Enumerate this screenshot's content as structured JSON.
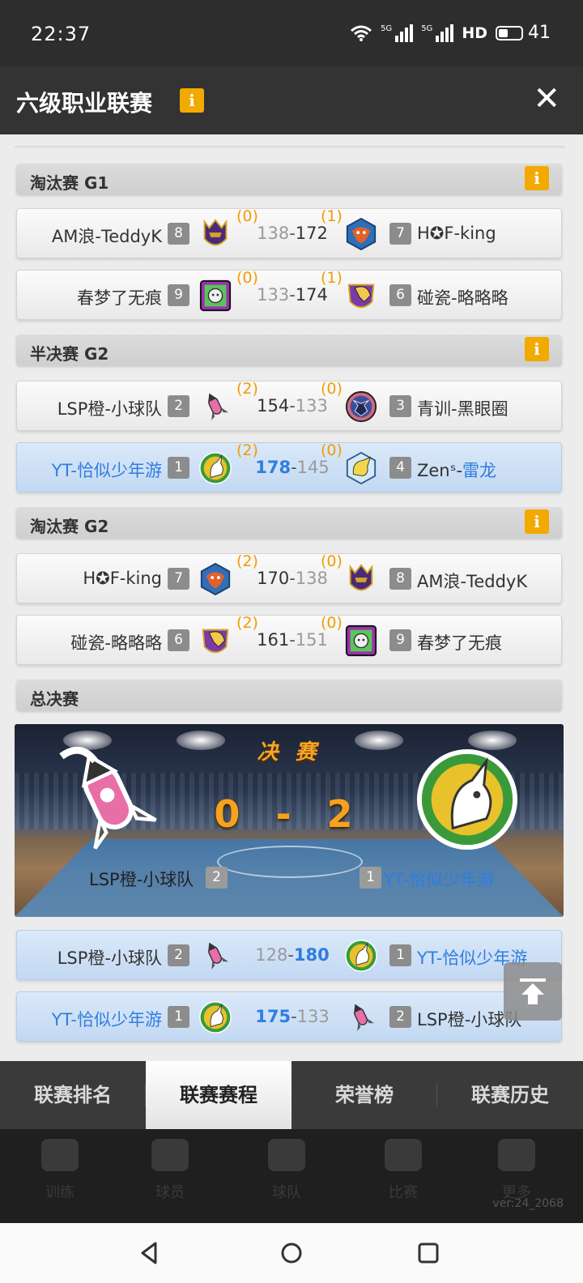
{
  "status_bar": {
    "time": "22:37",
    "network1": "5G",
    "network2": "5G",
    "hd": "HD",
    "battery": "41",
    "battery_level": 0.41
  },
  "header": {
    "title": "六级职业联赛",
    "info_icon": "i",
    "close_icon": "✕"
  },
  "sections": [
    {
      "title": "淘汰赛 G1",
      "info": "i",
      "rows": [
        {
          "left": "AM浪-TeddyK",
          "left_seed": "8",
          "left_logo": "knight-helmet-icon",
          "left_wins": "(0)",
          "left_score": "138",
          "right_score": "172",
          "right_wins": "(1)",
          "right_logo": "eagle-icon",
          "right_seed": "7",
          "right": "H✪F-king",
          "winner": "right",
          "highlight": false
        },
        {
          "left": "春梦了无痕",
          "left_seed": "9",
          "left_logo": "bear-icon",
          "left_wins": "(0)",
          "left_score": "133",
          "right_score": "174",
          "right_wins": "(1)",
          "right_logo": "spartan-helmet-icon",
          "right_seed": "6",
          "right": "碰瓷-略略略",
          "winner": "right",
          "highlight": false
        }
      ]
    },
    {
      "title": "半决赛 G2",
      "info": "i",
      "rows": [
        {
          "left": "LSP橙-小球队",
          "left_seed": "2",
          "left_logo": "rocket-icon",
          "left_wins": "(2)",
          "left_score": "154",
          "right_score": "133",
          "right_wins": "(0)",
          "right_logo": "wolf-icon",
          "right_seed": "3",
          "right": "青训-黑眼圈",
          "winner": "left",
          "highlight": false
        },
        {
          "left": "YT-恰似少年游",
          "left_seed": "1",
          "left_logo": "unicorn-icon",
          "left_wins": "(2)",
          "left_score": "178",
          "right_score": "145",
          "right_wins": "(0)",
          "right_logo": "dragon-icon",
          "right_seed": "4",
          "right_a": "Zenˢ-",
          "right_b": "雷龙",
          "winner": "left",
          "highlight": true
        }
      ]
    },
    {
      "title": "淘汰赛 G2",
      "info": "i",
      "rows": [
        {
          "left": "H✪F-king",
          "left_seed": "7",
          "left_logo": "eagle-icon",
          "left_wins": "(2)",
          "left_score": "170",
          "right_score": "138",
          "right_wins": "(0)",
          "right_logo": "knight-helmet-icon",
          "right_seed": "8",
          "right": "AM浪-TeddyK",
          "winner": "left",
          "highlight": false
        },
        {
          "left": "碰瓷-略略略",
          "left_seed": "6",
          "left_logo": "spartan-helmet-icon",
          "left_wins": "(2)",
          "left_score": "161",
          "right_score": "151",
          "right_wins": "(0)",
          "right_logo": "bear-icon",
          "right_seed": "9",
          "right": "春梦了无痕",
          "winner": "left",
          "highlight": false
        }
      ]
    },
    {
      "title": "总决赛",
      "info": ""
    }
  ],
  "final": {
    "title": "决 赛",
    "score": "0 - 2",
    "left_team": "LSP橙-小球队",
    "left_seed": "2",
    "right_team": "YT-恰似少年游",
    "right_seed": "1",
    "games": [
      {
        "left": "LSP橙-小球队",
        "left_seed": "2",
        "left_score": "128",
        "right_score": "180",
        "right_seed": "1",
        "right": "YT-恰似少年游",
        "winner": "right"
      },
      {
        "left": "YT-恰似少年游",
        "left_seed": "1",
        "left_score": "175",
        "right_score": "133",
        "right_seed": "2",
        "right": "LSP橙-小球队",
        "winner": "left"
      }
    ]
  },
  "tabs": [
    {
      "label": "联赛排名",
      "active": false
    },
    {
      "label": "联赛赛程",
      "active": true
    },
    {
      "label": "荣誉榜",
      "active": false
    },
    {
      "label": "联赛历史",
      "active": false
    }
  ],
  "game_nav": {
    "items": [
      "训练",
      "球员",
      "球队",
      "比赛",
      "更多"
    ],
    "version": "ver:24_2068"
  },
  "colors": {
    "accent_orange": "#f2a900",
    "win_blue": "#2f7de0",
    "wins_orange": "#f29c00"
  }
}
